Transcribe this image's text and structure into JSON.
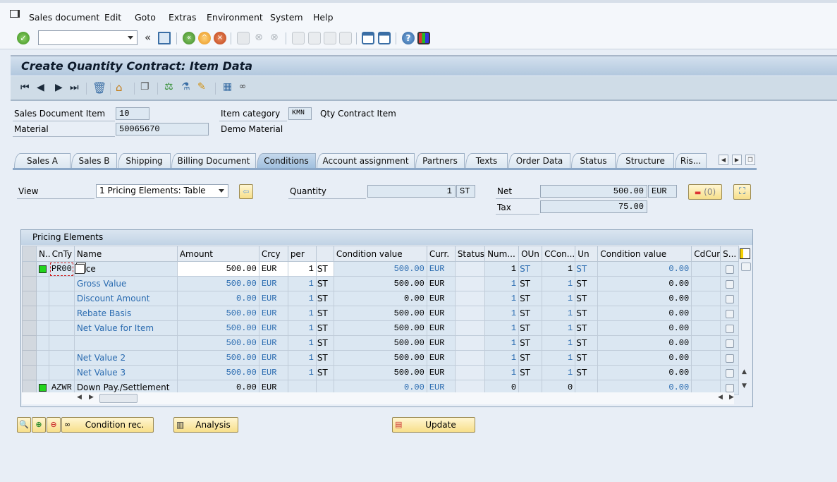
{
  "menubar": {
    "items": [
      "Sales document",
      "Edit",
      "Goto",
      "Extras",
      "Environment",
      "System",
      "Help"
    ]
  },
  "toolbar": {
    "command_field_value": "",
    "icons": [
      "enter-icon",
      "save-icon",
      "back-icon",
      "exit-icon",
      "cancel-icon",
      "print-icon",
      "find-icon",
      "find-next-icon",
      "first-page-icon",
      "previous-page-icon",
      "next-page-icon",
      "last-page-icon",
      "create-session-icon",
      "shortcut-icon",
      "help-icon",
      "customize-layout-icon"
    ]
  },
  "title": "Create Quantity Contract: Item Data",
  "app_toolbar": {
    "icons": [
      "first-item-icon",
      "previous-item-icon",
      "next-item-icon",
      "last-item-icon",
      "delete-icon",
      "header-icon",
      "display-document-icon",
      "configuration-icon",
      "batch-icon",
      "edit-icon",
      "calculator-icon",
      "display-condition-icon"
    ]
  },
  "header": {
    "sales_doc_item_label": "Sales Document Item",
    "sales_doc_item_value": "10",
    "item_category_label": "Item category",
    "item_category_value": "KMN",
    "item_category_text": "Qty Contract Item",
    "material_label": "Material",
    "material_value": "50065670",
    "material_text": "Demo Material"
  },
  "tabs": [
    {
      "label": "Sales A",
      "active": false
    },
    {
      "label": "Sales B",
      "active": false
    },
    {
      "label": "Shipping",
      "active": false
    },
    {
      "label": "Billing Document",
      "active": false
    },
    {
      "label": "Conditions",
      "active": true
    },
    {
      "label": "Account assignment",
      "active": false
    },
    {
      "label": "Partners",
      "active": false
    },
    {
      "label": "Texts",
      "active": false
    },
    {
      "label": "Order Data",
      "active": false
    },
    {
      "label": "Status",
      "active": false
    },
    {
      "label": "Structure",
      "active": false
    },
    {
      "label": "Ris...",
      "active": false
    }
  ],
  "conditions": {
    "view_label": "View",
    "view_value": "1 Pricing Elements: Table",
    "quantity_label": "Quantity",
    "quantity_value": "1",
    "quantity_unit": "ST",
    "net_label": "Net",
    "net_value": "500.00",
    "net_currency": "EUR",
    "tax_label": "Tax",
    "tax_value": "75.00",
    "messages_count": "(0)"
  },
  "pricing": {
    "title": "Pricing Elements",
    "columns": [
      "N..",
      "CnTy",
      "Name",
      "Amount",
      "Crcy",
      "per",
      "",
      "Condition value",
      "Curr.",
      "Status",
      "Num...",
      "OUn",
      "CCon...",
      "Un",
      "Condition value",
      "CdCur",
      "S..."
    ],
    "rows": [
      {
        "cnty": "PR00",
        "name": "Price",
        "amount": "500.00",
        "crcy": "EUR",
        "per": "1",
        "uom": "ST",
        "cond_value": "500.00",
        "curr": "EUR",
        "status": "",
        "num": "1",
        "oun": "ST",
        "ccon": "1",
        "un": "ST",
        "cond_value2": "0.00",
        "cdcur": "",
        "green": true
      },
      {
        "cnty": "",
        "name": "Gross Value",
        "amount": "500.00",
        "crcy": "EUR",
        "per": "1",
        "uom": "ST",
        "cond_value": "500.00",
        "curr": "EUR",
        "status": "",
        "num": "1",
        "oun": "ST",
        "ccon": "1",
        "un": "ST",
        "cond_value2": "0.00",
        "cdcur": "",
        "green": false
      },
      {
        "cnty": "",
        "name": "Discount Amount",
        "amount": "0.00",
        "crcy": "EUR",
        "per": "1",
        "uom": "ST",
        "cond_value": "0.00",
        "curr": "EUR",
        "status": "",
        "num": "1",
        "oun": "ST",
        "ccon": "1",
        "un": "ST",
        "cond_value2": "0.00",
        "cdcur": "",
        "green": false
      },
      {
        "cnty": "",
        "name": "Rebate Basis",
        "amount": "500.00",
        "crcy": "EUR",
        "per": "1",
        "uom": "ST",
        "cond_value": "500.00",
        "curr": "EUR",
        "status": "",
        "num": "1",
        "oun": "ST",
        "ccon": "1",
        "un": "ST",
        "cond_value2": "0.00",
        "cdcur": "",
        "green": false
      },
      {
        "cnty": "",
        "name": "Net Value for Item",
        "amount": "500.00",
        "crcy": "EUR",
        "per": "1",
        "uom": "ST",
        "cond_value": "500.00",
        "curr": "EUR",
        "status": "",
        "num": "1",
        "oun": "ST",
        "ccon": "1",
        "un": "ST",
        "cond_value2": "0.00",
        "cdcur": "",
        "green": false
      },
      {
        "cnty": "",
        "name": "",
        "amount": "500.00",
        "crcy": "EUR",
        "per": "1",
        "uom": "ST",
        "cond_value": "500.00",
        "curr": "EUR",
        "status": "",
        "num": "1",
        "oun": "ST",
        "ccon": "1",
        "un": "ST",
        "cond_value2": "0.00",
        "cdcur": "",
        "green": false
      },
      {
        "cnty": "",
        "name": "Net Value 2",
        "amount": "500.00",
        "crcy": "EUR",
        "per": "1",
        "uom": "ST",
        "cond_value": "500.00",
        "curr": "EUR",
        "status": "",
        "num": "1",
        "oun": "ST",
        "ccon": "1",
        "un": "ST",
        "cond_value2": "0.00",
        "cdcur": "",
        "green": false
      },
      {
        "cnty": "",
        "name": "Net Value 3",
        "amount": "500.00",
        "crcy": "EUR",
        "per": "1",
        "uom": "ST",
        "cond_value": "500.00",
        "curr": "EUR",
        "status": "",
        "num": "1",
        "oun": "ST",
        "ccon": "1",
        "un": "ST",
        "cond_value2": "0.00",
        "cdcur": "",
        "green": false
      },
      {
        "cnty": "AZWR",
        "name": "Down Pay./Settlement",
        "amount": "0.00",
        "crcy": "EUR",
        "per": "",
        "uom": "",
        "cond_value": "0.00",
        "curr": "EUR",
        "status": "",
        "num": "0",
        "oun": "",
        "ccon": "0",
        "un": "",
        "cond_value2": "0.00",
        "cdcur": "",
        "green": true
      }
    ]
  },
  "buttons": {
    "condition_rec": "Condition rec.",
    "analysis": "Analysis",
    "update": "Update"
  },
  "colors": {
    "accent_blue": "#2a6bb0",
    "status_green": "#22d41d",
    "button_yellow": "#f7df8a"
  }
}
